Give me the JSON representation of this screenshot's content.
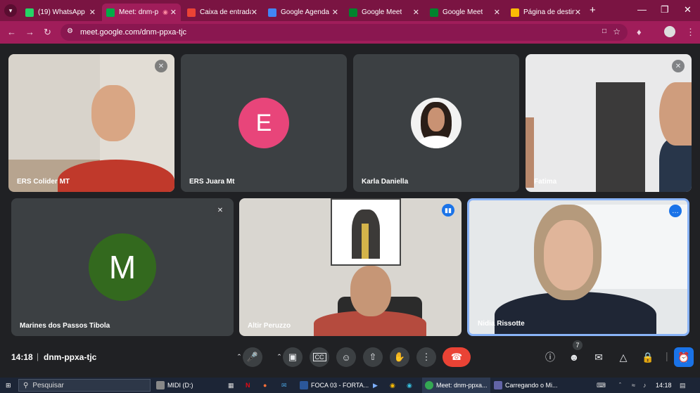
{
  "browser": {
    "tabs": [
      {
        "title": "(19) WhatsApp",
        "favicon_color": "#25d366",
        "active": false
      },
      {
        "title": "Meet: dnm-p",
        "favicon_color": "#00ac47",
        "active": true
      },
      {
        "title": "Caixa de entrada",
        "favicon_color": "#ea4335",
        "active": false
      },
      {
        "title": "Google Agenda",
        "favicon_color": "#4285f4",
        "active": false
      },
      {
        "title": "Google Meet",
        "favicon_color": "#00832d",
        "active": false
      },
      {
        "title": "Google Meet",
        "favicon_color": "#00832d",
        "active": false
      },
      {
        "title": "Página de destino",
        "favicon_color": "#fbbc04",
        "active": false
      }
    ],
    "url": "meet.google.com/dnm-ppxa-tjc",
    "theme_color": "#a01d5a"
  },
  "meeting": {
    "time": "14:18",
    "code": "dnm-ppxa-tjc",
    "participant_count": "7",
    "participants": [
      {
        "name": "ERS Colider MT",
        "type": "video",
        "muted": true
      },
      {
        "name": "ERS Juara Mt",
        "type": "avatar",
        "initial": "E",
        "avatar_color": "#e8457a",
        "muted": false
      },
      {
        "name": "Karla Daniella",
        "type": "photo",
        "muted": false
      },
      {
        "name": "Fatima",
        "type": "video",
        "muted": true
      },
      {
        "name": "Marines dos Passos Tibola",
        "type": "avatar",
        "initial": "M",
        "avatar_color": "#33691e",
        "muted": true
      },
      {
        "name": "Altir Peruzzo",
        "type": "video",
        "speaking": true
      },
      {
        "name": "Nidia Rissotte",
        "type": "video",
        "self": true
      }
    ],
    "end_call_color": "#ea4335",
    "accent": "#8ab4f8"
  },
  "taskbar": {
    "search_placeholder": "Pesquisar",
    "items": [
      "MIDI (D:)",
      "FOCA 03 - FORTA...",
      "Meet: dnm-ppxa...",
      "Carregando o Mi..."
    ],
    "clock": "14:18"
  }
}
